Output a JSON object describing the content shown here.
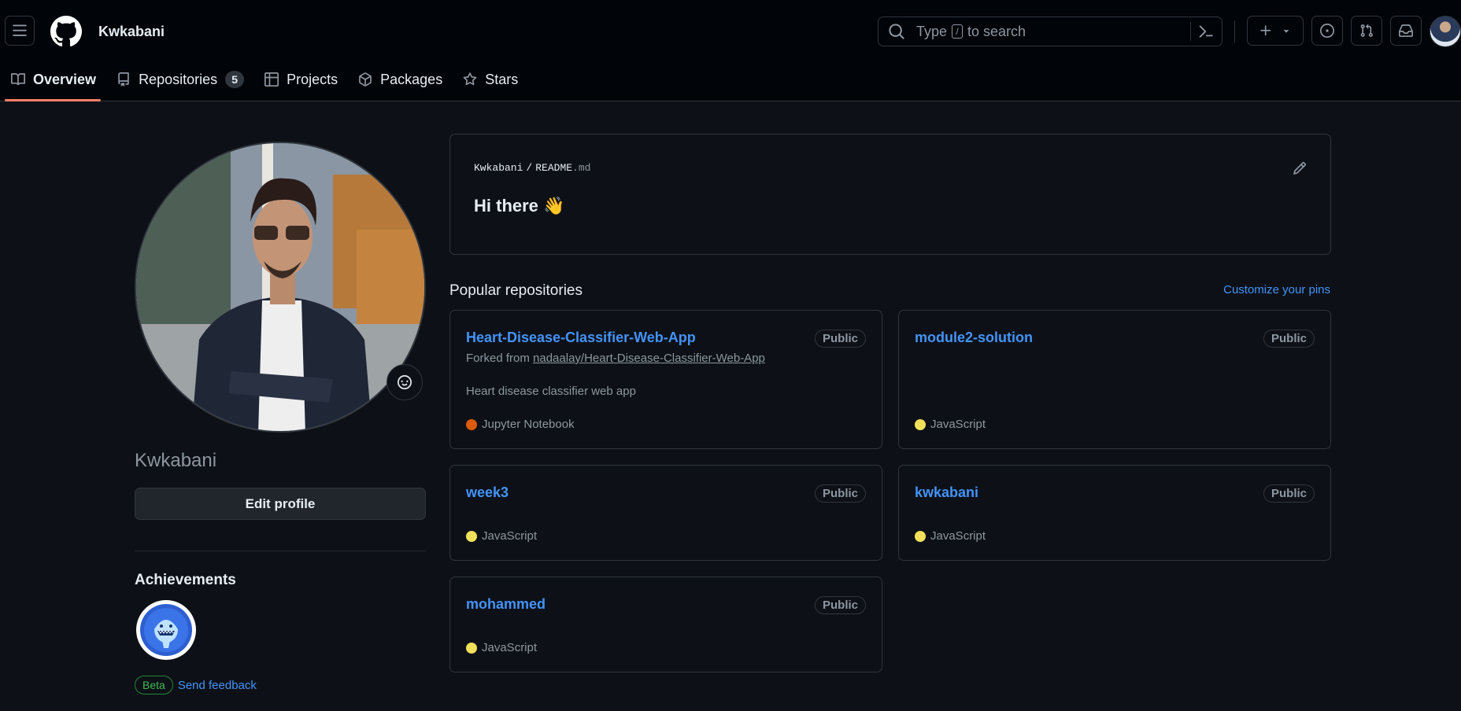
{
  "header": {
    "username": "Kwkabani",
    "search": {
      "prefix": "Type",
      "key": "/",
      "suffix": "to search"
    }
  },
  "tabs": [
    {
      "label": "Overview",
      "icon": "book-icon"
    },
    {
      "label": "Repositories",
      "icon": "repo-icon",
      "count": "5"
    },
    {
      "label": "Projects",
      "icon": "table-icon"
    },
    {
      "label": "Packages",
      "icon": "package-icon"
    },
    {
      "label": "Stars",
      "icon": "star-icon"
    }
  ],
  "sidebar": {
    "username": "Kwkabani",
    "edit_profile": "Edit profile",
    "achievements_title": "Achievements",
    "beta_label": "Beta",
    "feedback_label": "Send feedback"
  },
  "readme": {
    "owner": "Kwkabani",
    "separator": "/",
    "file_base": "README",
    "file_ext": ".md",
    "heading": "Hi there 👋"
  },
  "popular": {
    "title": "Popular repositories",
    "customize": "Customize your pins",
    "repos": [
      {
        "name": "Heart-Disease-Classifier-Web-App",
        "visibility": "Public",
        "fork_prefix": "Forked from",
        "fork_source": "nadaalay/Heart-Disease-Classifier-Web-App",
        "description": "Heart disease classifier web app",
        "language": "Jupyter Notebook",
        "lang_color": "#DA5B0B"
      },
      {
        "name": "module2-solution",
        "visibility": "Public",
        "language": "JavaScript",
        "lang_color": "#f1e05a"
      },
      {
        "name": "week3",
        "visibility": "Public",
        "language": "JavaScript",
        "lang_color": "#f1e05a"
      },
      {
        "name": "kwkabani",
        "visibility": "Public",
        "language": "JavaScript",
        "lang_color": "#f1e05a"
      },
      {
        "name": "mohammed",
        "visibility": "Public",
        "language": "JavaScript",
        "lang_color": "#f1e05a"
      }
    ]
  },
  "colors": {
    "background": "#0d1117",
    "header_bg": "#010409",
    "link": "#4493f8",
    "active_tab_underline": "#f78166",
    "border": "#30363d"
  }
}
